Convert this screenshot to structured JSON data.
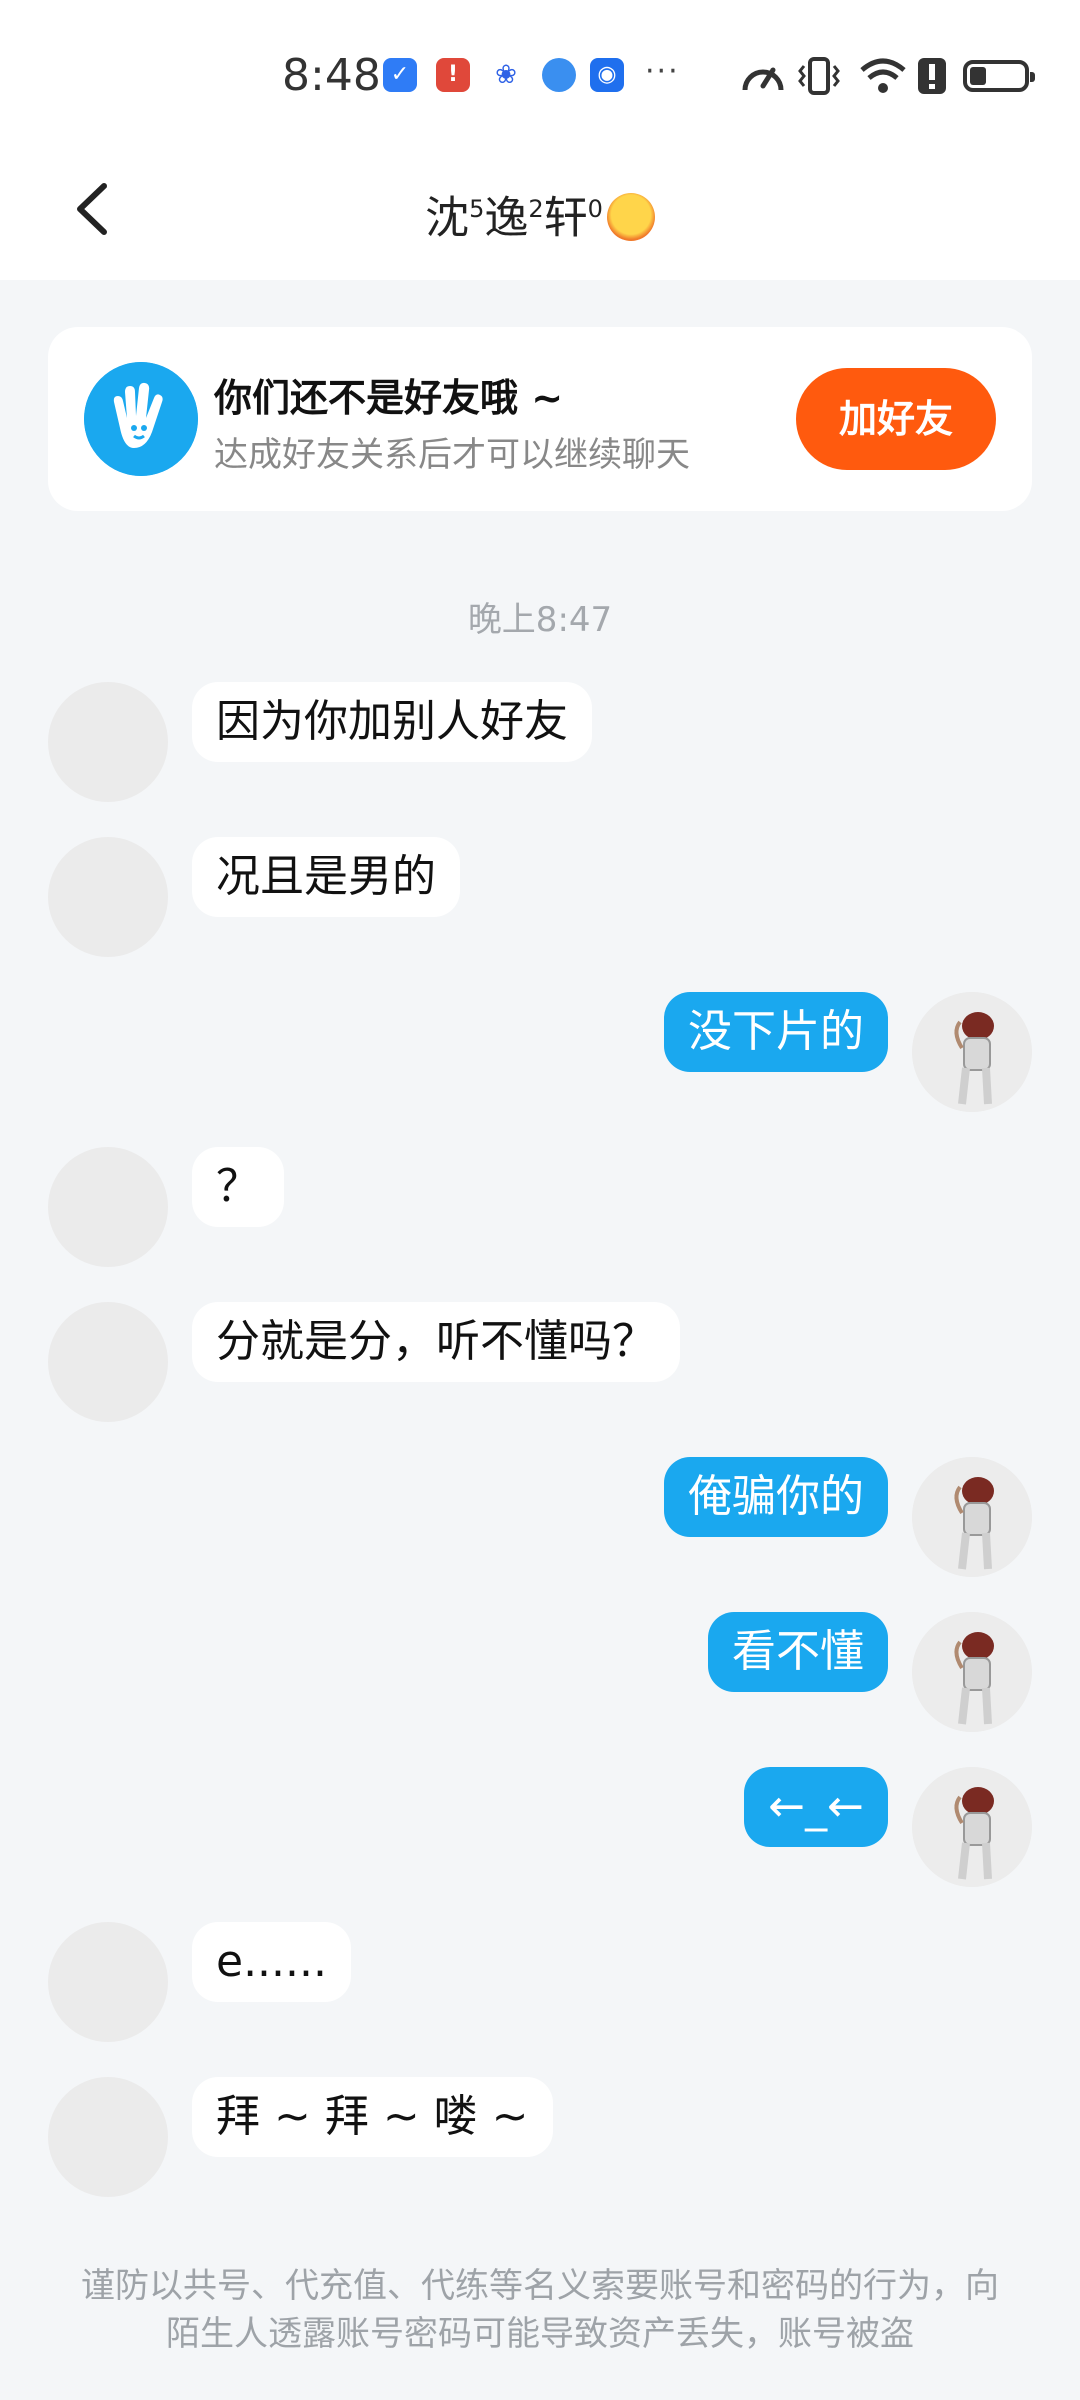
{
  "status_bar": {
    "time": "8:48",
    "more": "···",
    "icons": [
      "shield-app-icon",
      "alert-app-icon",
      "paw-app-icon",
      "sphere-app-icon",
      "bulb-app-icon",
      "speedometer-icon",
      "vibrate-icon",
      "wifi-icon",
      "alert-icon",
      "battery-icon"
    ]
  },
  "header": {
    "title_parts": [
      "沈",
      "5",
      "逸",
      "2",
      "轩",
      "0"
    ],
    "title_emoji": "hot-face-emoji"
  },
  "friend_card": {
    "title": "你们还不是好友哦 ~",
    "subtitle": "达成好友关系后才可以继续聊天",
    "button": "加好友"
  },
  "chat": {
    "timestamp": "晚上8:47",
    "messages": [
      {
        "side": "in",
        "text": "因为你加别人好友"
      },
      {
        "side": "in",
        "text": "况且是男的"
      },
      {
        "side": "out",
        "text": "没下片的"
      },
      {
        "side": "in",
        "text": "？"
      },
      {
        "side": "in",
        "text": "分就是分，听不懂吗？"
      },
      {
        "side": "out",
        "text": "俺骗你的"
      },
      {
        "side": "out",
        "text": "看不懂"
      },
      {
        "side": "out",
        "text": "←_←"
      },
      {
        "side": "in",
        "text": "e......"
      },
      {
        "side": "in",
        "text": "拜 ~ 拜 ~ 喽 ~"
      }
    ]
  },
  "footer": {
    "notice": "谨防以共号、代充值、代练等名义索要账号和密码的行为，向陌生人透露账号密码可能导致资产丢失，账号被盗"
  },
  "colors": {
    "accent_blue": "#1aa8ef",
    "add_button": "#ff5a0e",
    "background": "#f4f6f8"
  }
}
